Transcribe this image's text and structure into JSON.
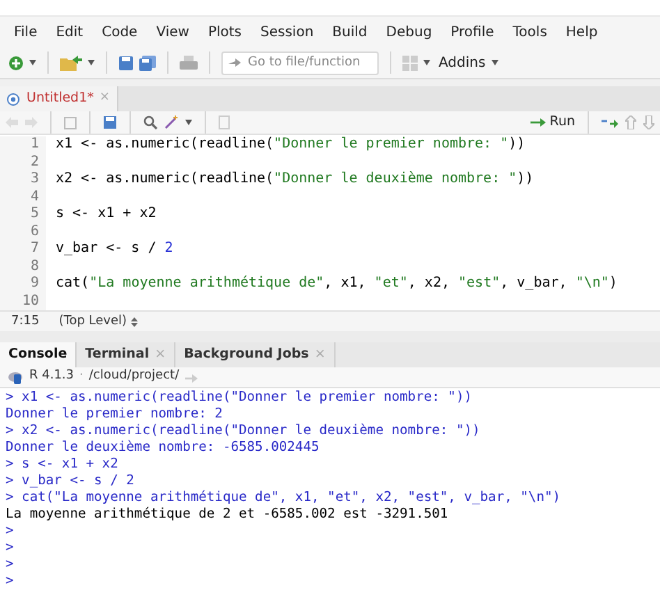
{
  "menu": [
    "File",
    "Edit",
    "Code",
    "View",
    "Plots",
    "Session",
    "Build",
    "Debug",
    "Profile",
    "Tools",
    "Help"
  ],
  "toolbar": {
    "search_placeholder": "Go to file/function",
    "addins": "Addins"
  },
  "editor": {
    "tab": {
      "title": "Untitled1*",
      "modified": true,
      "close": "×"
    },
    "run_label": "Run",
    "lines": [
      {
        "number": "1",
        "tokens": [
          {
            "kind": "code",
            "text": "x1 <- as.numeric(readline("
          },
          {
            "kind": "string",
            "text": "\"Donner le premier nombre: \""
          },
          {
            "kind": "code",
            "text": "))"
          }
        ]
      },
      {
        "number": "2"
      },
      {
        "number": "3",
        "tokens": [
          {
            "kind": "code",
            "text": "x2 <- as.numeric(readline("
          },
          {
            "kind": "string",
            "text": "\"Donner le deuxième nombre: \""
          },
          {
            "kind": "code",
            "text": "))"
          }
        ]
      },
      {
        "number": "4"
      },
      {
        "number": "5",
        "tokens": [
          {
            "kind": "code",
            "text": "s <- x1 + x2"
          }
        ]
      },
      {
        "number": "6"
      },
      {
        "number": "7",
        "tokens": [
          {
            "kind": "code",
            "text": "v_bar <- s / "
          },
          {
            "kind": "number",
            "text": "2"
          }
        ]
      },
      {
        "number": "8"
      },
      {
        "number": "9",
        "tokens": [
          {
            "kind": "code",
            "text": "cat("
          },
          {
            "kind": "string",
            "text": "\"La moyenne arithmétique de\""
          },
          {
            "kind": "code",
            "text": ", x1, "
          },
          {
            "kind": "string",
            "text": "\"et\""
          },
          {
            "kind": "code",
            "text": ", x2, "
          },
          {
            "kind": "string",
            "text": "\"est\""
          },
          {
            "kind": "code",
            "text": ", v_bar, "
          },
          {
            "kind": "string",
            "text": "\"\\n\""
          },
          {
            "kind": "code",
            "text": ")"
          }
        ]
      },
      {
        "number": "10"
      }
    ],
    "status": {
      "position": "7:15",
      "scope": "(Top Level)"
    }
  },
  "console": {
    "tabs": [
      {
        "label": "Console",
        "selected": true
      },
      {
        "label": "Terminal",
        "selected": false,
        "close": "×"
      },
      {
        "label": "Background Jobs",
        "selected": false,
        "close": "×"
      }
    ],
    "version": "R 4.1.3",
    "separator": "·",
    "path": "/cloud/project/",
    "lines": [
      {
        "kind": "input",
        "text": "> x1 <- as.numeric(readline(\"Donner le premier nombre: \"))"
      },
      {
        "kind": "input",
        "text": "Donner le premier nombre: 2"
      },
      {
        "kind": "input",
        "text": "> x2 <- as.numeric(readline(\"Donner le deuxième nombre: \"))"
      },
      {
        "kind": "input",
        "text": "Donner le deuxième nombre: -6585.002445"
      },
      {
        "kind": "input",
        "text": "> s <- x1 + x2"
      },
      {
        "kind": "input",
        "text": "> v_bar <- s / 2"
      },
      {
        "kind": "input",
        "text": "> cat(\"La moyenne arithmétique de\", x1, \"et\", x2, \"est\", v_bar, \"\\n\")"
      },
      {
        "kind": "output",
        "text": "La moyenne arithmétique de 2 et -6585.002 est -3291.501"
      },
      {
        "kind": "input",
        "text": ">"
      },
      {
        "kind": "input",
        "text": ">"
      },
      {
        "kind": "input",
        "text": ">"
      },
      {
        "kind": "input",
        "text": ">"
      }
    ]
  }
}
